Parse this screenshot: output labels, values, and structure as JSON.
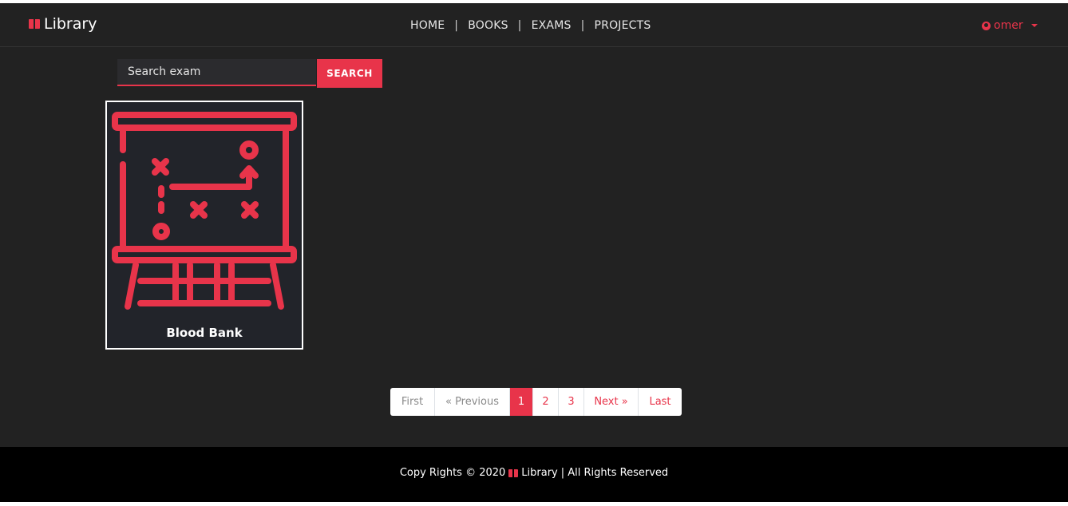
{
  "navbar": {
    "brand": "Library",
    "links": [
      "HOME",
      "BOOKS",
      "EXAMS",
      "PROJECTS"
    ],
    "separator": "|",
    "user": "omer"
  },
  "search": {
    "placeholder": "Search exam",
    "button_label": "SEARCH"
  },
  "cards": [
    {
      "title": "Blood Bank",
      "icon": "presentation-board-strategy-icon"
    }
  ],
  "pagination": {
    "first": "First",
    "previous": "« Previous",
    "pages": [
      "1",
      "2",
      "3"
    ],
    "active_page": "1",
    "next": "Next »",
    "last": "Last"
  },
  "footer": {
    "text_before": "Copy Rights © 2020",
    "brand": "Library",
    "text_after": "| All Rights Reserved"
  },
  "colors": {
    "accent": "#e8344a",
    "background": "#222222",
    "card_background": "#22242a",
    "footer_background": "#000000"
  }
}
